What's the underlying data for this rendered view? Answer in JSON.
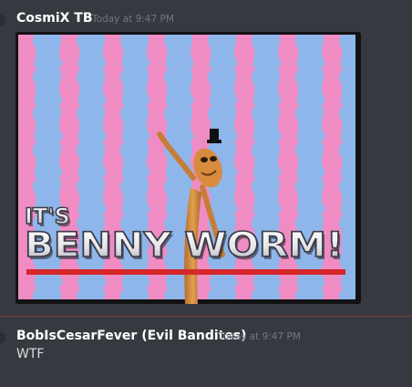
{
  "messages": [
    {
      "author": "CosmiX TB",
      "timestamp": "Today at 9:47 PM",
      "attachment": {
        "type": "image",
        "caption_line1": "IT'S",
        "caption_line2": "BENNY WORM!"
      }
    },
    {
      "author": "BobIsCesarFever (Evil Bandites)",
      "timestamp": "Today at 9:47 PM",
      "text": "WTF"
    }
  ],
  "colors": {
    "background": "#36393f",
    "username": "#ffffff",
    "timestamp": "#72767d",
    "message_text": "#dcddde",
    "divider": "#7a3b3b",
    "stripe_pink": "#f08cc4",
    "stripe_blue": "#8fb6ea",
    "worm": "#d68a3a",
    "underline_red": "#d6282a"
  }
}
